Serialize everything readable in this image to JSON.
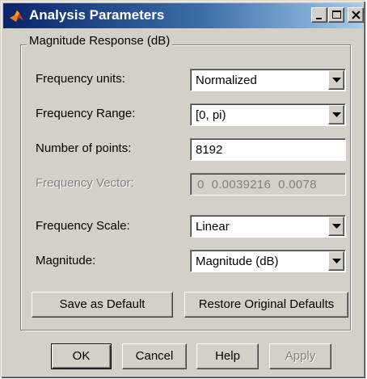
{
  "window": {
    "title": "Analysis Parameters",
    "app_icon": "matlab-icon",
    "title_buttons": [
      "minimize",
      "maximize",
      "close"
    ],
    "accent_color": "#0a246a"
  },
  "group": {
    "legend": "Magnitude Response (dB)"
  },
  "fields": {
    "frequency_units": {
      "label": "Frequency units:",
      "value": "Normalized"
    },
    "frequency_range": {
      "label": "Frequency Range:",
      "value": "[0, pi)"
    },
    "number_of_points": {
      "label": "Number of points:",
      "value": "8192"
    },
    "frequency_vector": {
      "label": "Frequency Vector:",
      "value": "0  0.0039216  0.0078"
    },
    "frequency_scale": {
      "label": "Frequency Scale:",
      "value": "Linear"
    },
    "magnitude": {
      "label": "Magnitude:",
      "value": "Magnitude (dB)"
    }
  },
  "defaults_buttons": {
    "save": "Save as Default",
    "restore": "Restore Original Defaults"
  },
  "dialog_buttons": {
    "ok": "OK",
    "cancel": "Cancel",
    "help": "Help",
    "apply": "Apply"
  }
}
